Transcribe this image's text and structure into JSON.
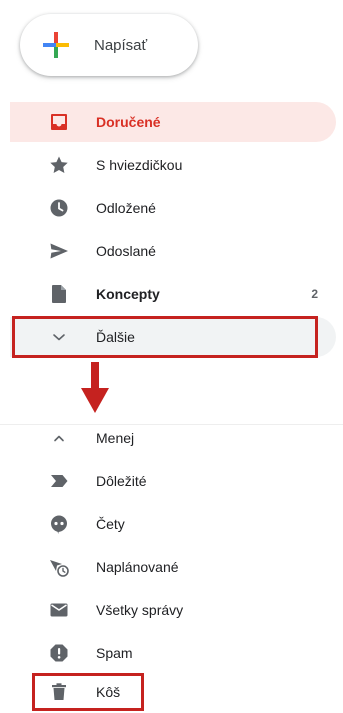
{
  "compose": {
    "label": "Napísať"
  },
  "top_items": [
    {
      "label": "Doručené",
      "icon": "inbox-icon",
      "active": true
    },
    {
      "label": "S hviezdičkou",
      "icon": "star-icon"
    },
    {
      "label": "Odložené",
      "icon": "clock-icon"
    },
    {
      "label": "Odoslané",
      "icon": "send-icon"
    },
    {
      "label": "Koncepty",
      "icon": "draft-icon",
      "count": "2",
      "bold": true
    },
    {
      "label": "Ďalšie",
      "icon": "chevron-down-icon"
    }
  ],
  "bottom_items": [
    {
      "label": "Menej",
      "icon": "chevron-up-icon"
    },
    {
      "label": "Dôležité",
      "icon": "important-icon"
    },
    {
      "label": "Čety",
      "icon": "chat-icon"
    },
    {
      "label": "Naplánované",
      "icon": "scheduled-icon"
    },
    {
      "label": "Všetky správy",
      "icon": "mail-icon"
    },
    {
      "label": "Spam",
      "icon": "spam-icon"
    },
    {
      "label": "Kôš",
      "icon": "trash-icon"
    }
  ],
  "colors": {
    "active_text": "#d93025",
    "active_bg": "#fce8e6",
    "icon_gray": "#5f6368",
    "highlight_red": "#c5221f"
  }
}
